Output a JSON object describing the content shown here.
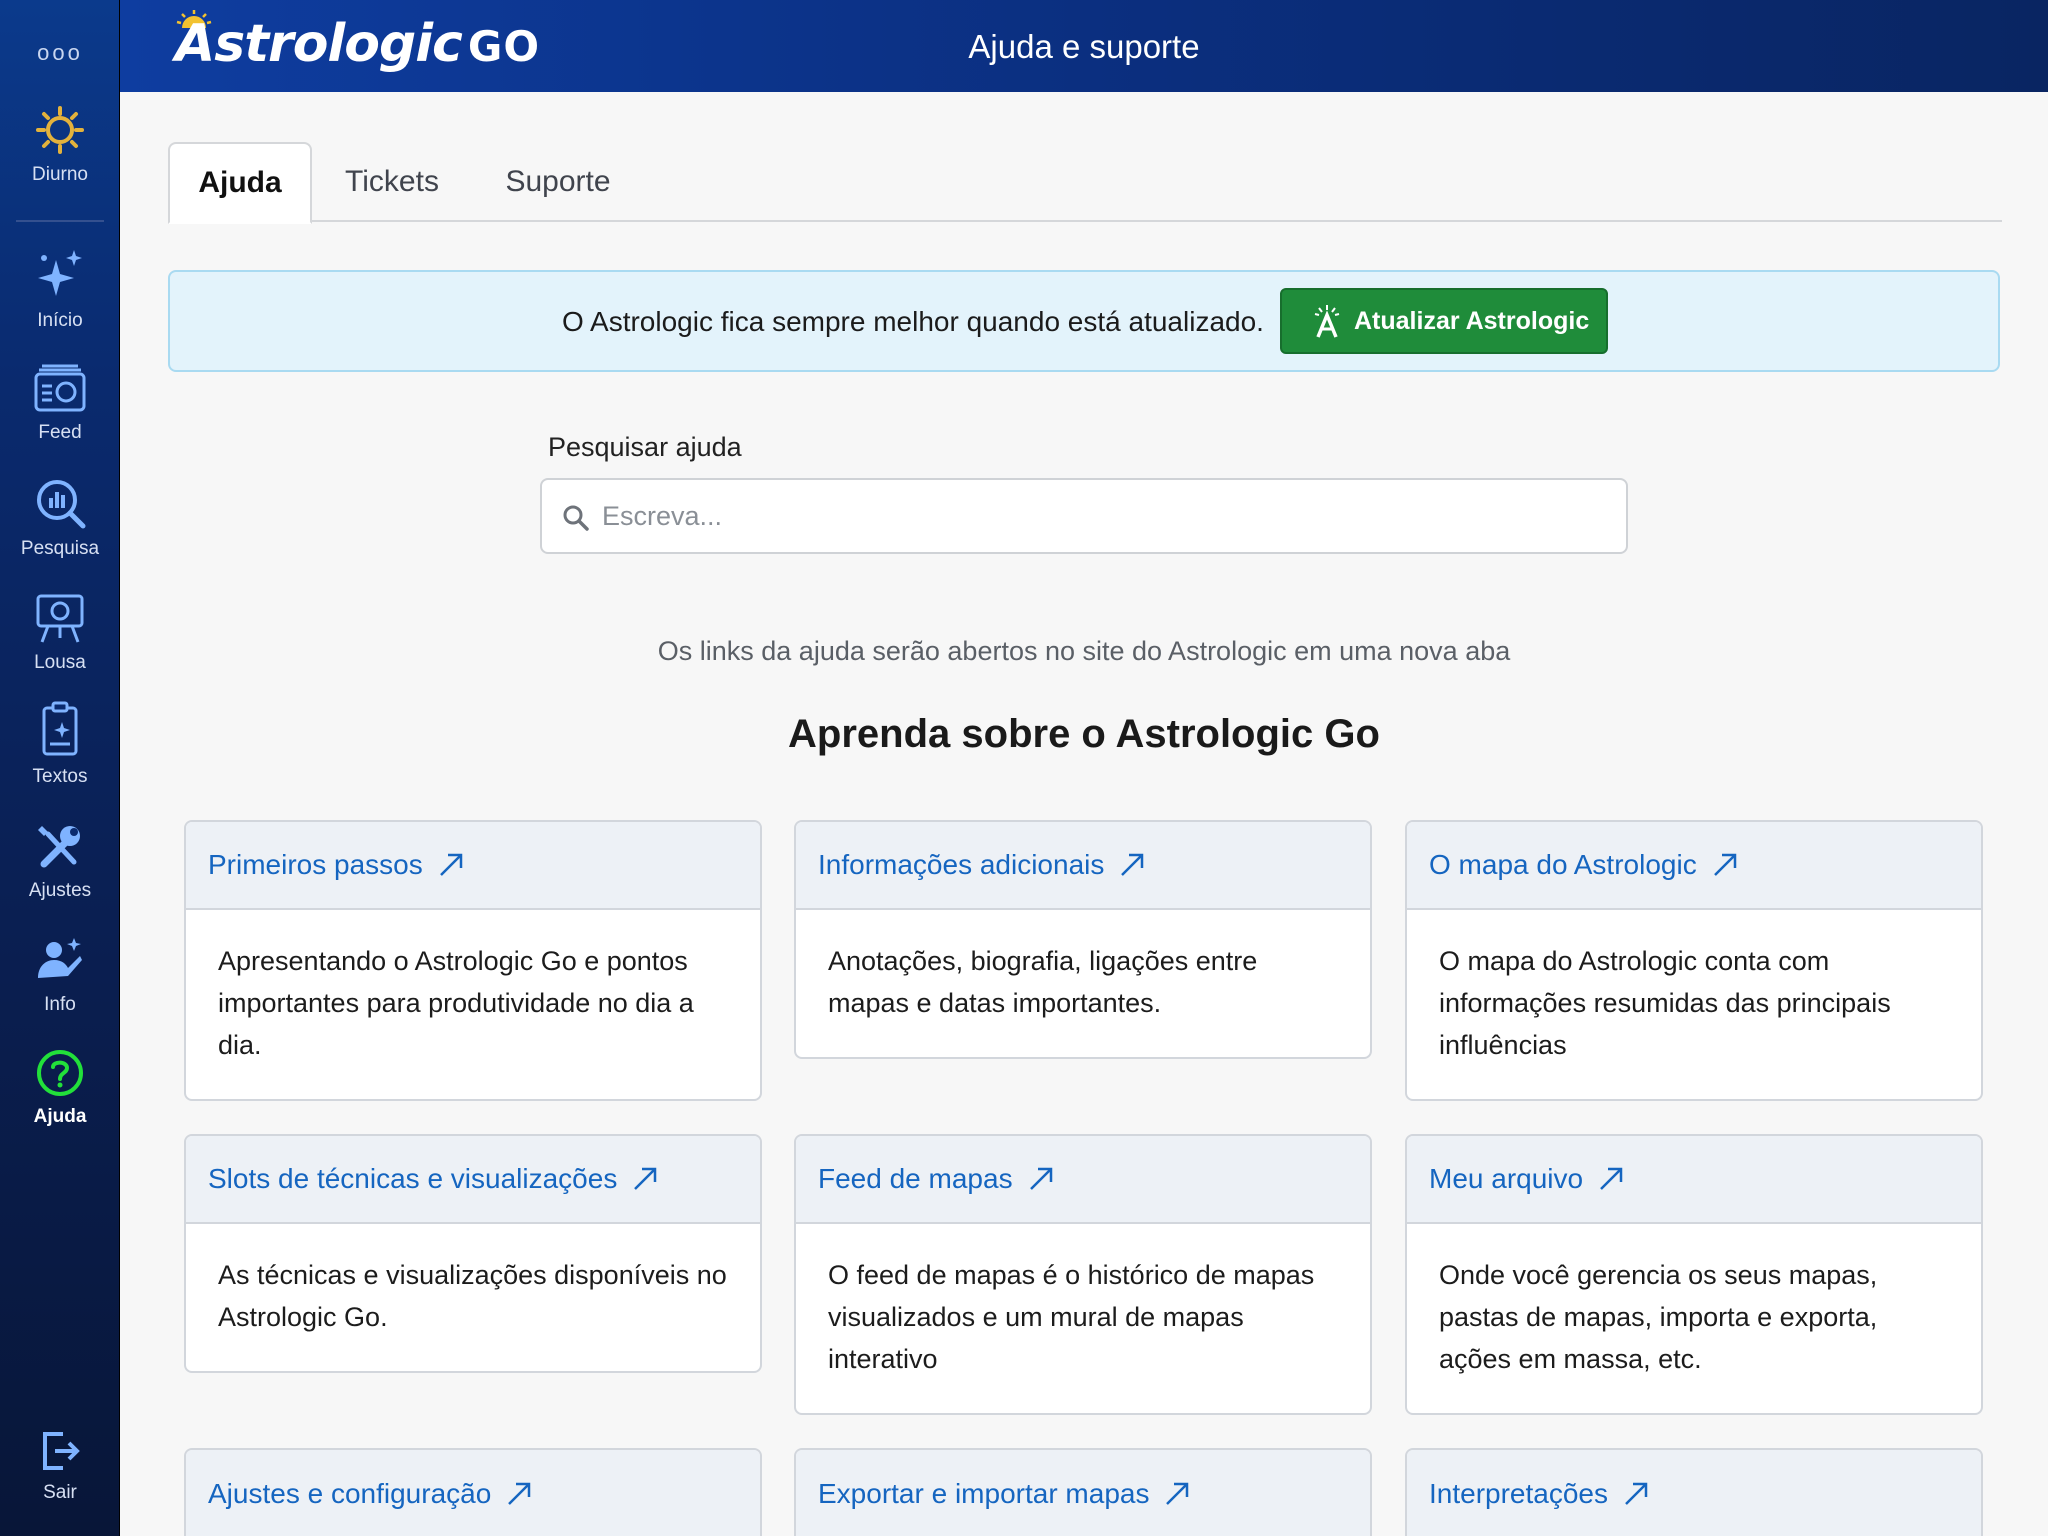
{
  "sidebar": {
    "more_dots": "ooo",
    "items": [
      {
        "label": "Diurno",
        "icon": "sun-icon"
      },
      {
        "label": "Início",
        "icon": "sparkles-icon"
      },
      {
        "label": "Feed",
        "icon": "feed-icon"
      },
      {
        "label": "Pesquisa",
        "icon": "search-chart-icon"
      },
      {
        "label": "Lousa",
        "icon": "easel-icon"
      },
      {
        "label": "Textos",
        "icon": "document-icon"
      },
      {
        "label": "Ajustes",
        "icon": "tools-icon"
      },
      {
        "label": "Info",
        "icon": "person-icon"
      },
      {
        "label": "Ajuda",
        "icon": "help-icon",
        "active": true
      },
      {
        "label": "Sair",
        "icon": "logout-icon"
      }
    ]
  },
  "header": {
    "logo_text": "Astrologic",
    "logo_suffix": "GO",
    "title": "Ajuda e suporte"
  },
  "tabs": [
    {
      "label": "Ajuda",
      "active": true
    },
    {
      "label": "Tickets"
    },
    {
      "label": "Suporte"
    }
  ],
  "banner": {
    "text": "O Astrologic fica sempre melhor quando está atualizado.",
    "button_label": "Atualizar Astrologic"
  },
  "search": {
    "label": "Pesquisar ajuda",
    "placeholder": "Escreva...",
    "value": ""
  },
  "note": "Os links da ajuda serão abertos no site do Astrologic em uma nova aba",
  "heading": "Aprenda sobre o Astrologic Go",
  "cards": [
    {
      "title": "Primeiros passos",
      "body": "Apresentando o Astrologic Go e pontos importantes para produtividade no dia a dia."
    },
    {
      "title": "Informações adicionais",
      "body": "Anotações, biografia, ligações entre mapas e datas importantes."
    },
    {
      "title": "O mapa do Astrologic",
      "body": "O mapa do Astrologic conta com informações resumidas das principais influências"
    },
    {
      "title": "Slots de técnicas e visualizações",
      "body": "As técnicas e visualizações disponíveis no Astrologic Go."
    },
    {
      "title": "Feed de mapas",
      "body": "O feed de mapas é o histórico de mapas visualizados e um mural de mapas interativo"
    },
    {
      "title": "Meu arquivo",
      "body": "Onde você gerencia os seus mapas, pastas de mapas, importa e exporta, ações em massa, etc."
    },
    {
      "title": "Ajustes e configuração",
      "body": ""
    },
    {
      "title": "Exportar e importar mapas",
      "body": ""
    },
    {
      "title": "Interpretações",
      "body": ""
    }
  ],
  "colors": {
    "sidebar": "#0a2a6e",
    "topbar": "#0b2f80",
    "link": "#1565c0",
    "update_button": "#1f8c3a",
    "banner_bg": "#e3f3fb",
    "help_active": "#22e03a",
    "sun_icon": "#e3b23c"
  }
}
